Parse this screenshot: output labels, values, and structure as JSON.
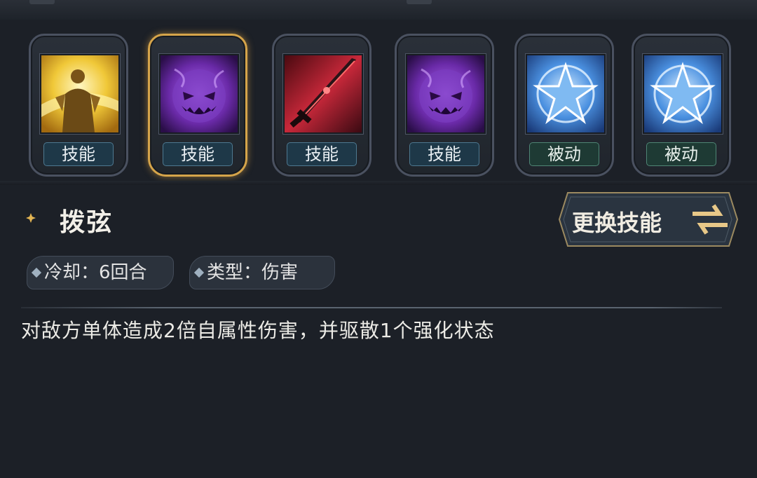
{
  "skill_slots": [
    {
      "label": "技能",
      "kind": "skill",
      "icon": "golden-warrior-icon",
      "selected": false
    },
    {
      "label": "技能",
      "kind": "skill",
      "icon": "purple-ghost-icon",
      "selected": true
    },
    {
      "label": "技能",
      "kind": "skill",
      "icon": "red-blade-icon",
      "selected": false
    },
    {
      "label": "技能",
      "kind": "skill",
      "icon": "purple-ghost-icon",
      "selected": false
    },
    {
      "label": "被动",
      "kind": "passive",
      "icon": "blue-star-icon",
      "selected": false
    },
    {
      "label": "被动",
      "kind": "passive",
      "icon": "blue-star-icon",
      "selected": false
    }
  ],
  "detail": {
    "name": "拨弦",
    "cooldown": "冷却：6回合",
    "type": "类型：伤害",
    "description": "对敌方单体造成2倍自属性伤害，并驱散1个强化状态"
  },
  "change_button": {
    "label": "更换技能"
  },
  "colors": {
    "background": "#1c2027",
    "selected_border": "#d5a44a",
    "skill_tag": "#1e3848",
    "passive_tag": "#1e3a34"
  }
}
